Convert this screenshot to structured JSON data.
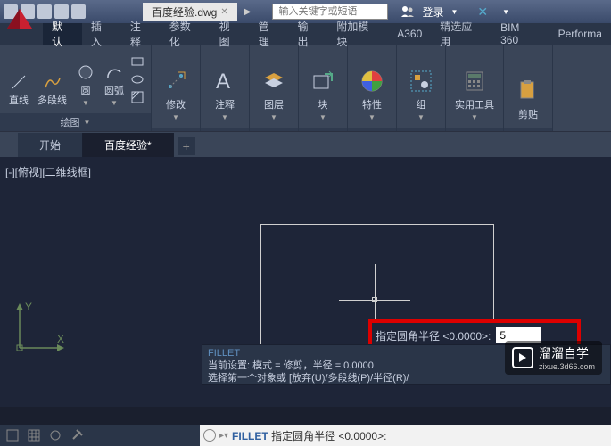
{
  "titlebar": {
    "doc_name": "百度经验.dwg",
    "search_placeholder": "输入关键字或短语",
    "login": "登录"
  },
  "menu": {
    "tabs": [
      "默认",
      "插入",
      "注释",
      "参数化",
      "视图",
      "管理",
      "输出",
      "附加模块",
      "A360",
      "精选应用",
      "BIM 360",
      "Performa"
    ]
  },
  "ribbon": {
    "draw_group": "绘图",
    "line": "直线",
    "polyline": "多段线",
    "circle": "圆",
    "arc": "圆弧",
    "modify": "修改",
    "annotate": "注释",
    "layers": "图层",
    "block": "块",
    "properties": "特性",
    "group": "组",
    "utilities": "实用工具",
    "clipboard": "剪贴"
  },
  "doctabs": {
    "start": "开始",
    "doc1": "百度经验*"
  },
  "canvas": {
    "view_label": "[-][俯视][二维线框]"
  },
  "prompt": {
    "label": "指定圆角半径 <0.0000>:",
    "value": "5"
  },
  "ucs": {
    "x": "X",
    "y": "Y"
  },
  "cmdwin": {
    "cmd": "FILLET",
    "line1": "当前设置: 模式 = 修剪，半径 = 0.0000",
    "line2": "选择第一个对象或 [放弃(U)/多段线(P)/半径(R)/"
  },
  "cmdline": {
    "cmd": "FILLET",
    "text": "指定圆角半径 <0.0000>:"
  },
  "watermark": {
    "text": "溜溜自学",
    "url": "zixue.3d66.com"
  }
}
